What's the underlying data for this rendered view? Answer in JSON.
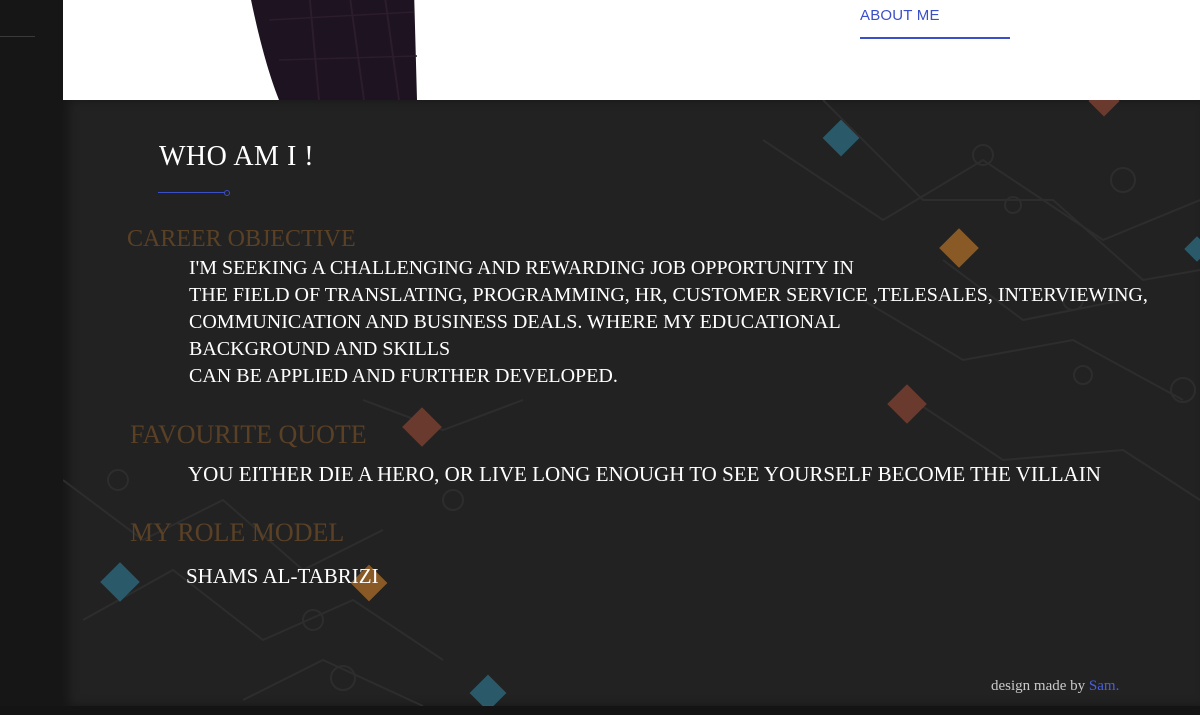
{
  "nav": {
    "about_label": "ABOUT ME"
  },
  "main": {
    "title": "WHO AM I !",
    "sections": [
      {
        "heading": "CAREER OBJECTIVE",
        "lines": [
          "I'M SEEKING A CHALLENGING AND REWARDING JOB OPPORTUNITY IN",
          "THE FIELD OF TRANSLATING, PROGRAMMING, HR, CUSTOMER SERVICE ,TELESALES, INTERVIEWING,",
          "COMMUNICATION AND BUSINESS DEALS. WHERE MY EDUCATIONAL",
          "BACKGROUND AND SKILLS",
          "CAN BE APPLIED AND FURTHER DEVELOPED."
        ]
      },
      {
        "heading": "FAVOURITE QUOTE",
        "text": "YOU EITHER DIE A HERO, OR LIVE LONG ENOUGH TO SEE YOURSELF BECOME THE VILLAIN"
      },
      {
        "heading": "MY ROLE MODEL",
        "text": "SHAMS AL-TABRIZI"
      }
    ]
  },
  "footer": {
    "credit_prefix": "design made by",
    "credit_author": "Sam."
  },
  "colors": {
    "accent": "#3b4fc8",
    "heading": "#5a4126",
    "panel_bg": "#222222",
    "text": "#ffffff"
  }
}
